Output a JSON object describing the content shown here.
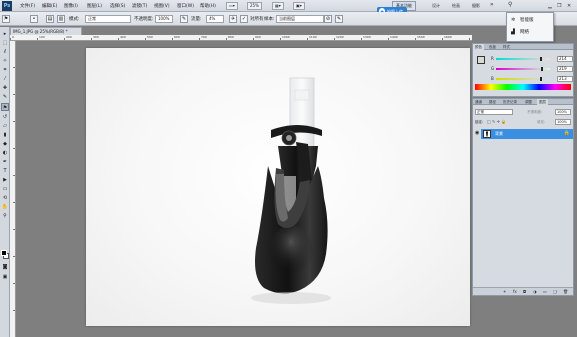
{
  "menubar": {
    "logo": "Ps",
    "items": [
      "文件(F)",
      "编辑(E)",
      "图像(I)",
      "图层(L)",
      "选择(S)",
      "滤镜(T)",
      "视图(V)",
      "窗口(W)",
      "帮助(H)"
    ],
    "zoom": "25%",
    "workspace_button": "基本功能",
    "workspace_tabs": [
      "设计",
      "绘画",
      "摄影"
    ],
    "more_label": "»"
  },
  "options": {
    "mode_label": "模式:",
    "mode_value": "正常",
    "opacity_label": "不透明度:",
    "opacity_value": "100%",
    "flow_label": "流量:",
    "flow_value": "4%",
    "sample_all_label": "对所有",
    "sample_label": "样本:",
    "sample_value": "当前图层"
  },
  "document": {
    "tab_title": "IMG_1.JPG @ 25%(RGB/8) *"
  },
  "ruler": {
    "numbers": [
      "0",
      "100",
      "200",
      "300",
      "400",
      "500",
      "600",
      "700",
      "800",
      "900",
      "1000",
      "1100",
      "1200",
      "1300",
      "1400",
      "1500",
      "1600"
    ]
  },
  "popup": {
    "pill_label": "拍照上传",
    "pill_icon": "cloud-icon",
    "items": [
      {
        "icon": "sparkle-icon",
        "label": "智能版"
      },
      {
        "icon": "signal-icon",
        "label": "网络"
      }
    ]
  },
  "color_panel": {
    "tabs": [
      "颜色",
      "色板",
      "样式"
    ],
    "channels": [
      {
        "name": "R",
        "value": "214",
        "fraction": 0.84
      },
      {
        "name": "G",
        "value": "219",
        "fraction": 0.86
      },
      {
        "name": "B",
        "value": "213",
        "fraction": 0.84
      }
    ]
  },
  "layers_panel": {
    "tabs": [
      "通道",
      "路径",
      "历史记录",
      "调整",
      "图层"
    ],
    "blend_mode": "正常",
    "opacity_label": "不透明度:",
    "opacity_value": "100%",
    "lock_label": "锁定:",
    "fill_label": "填充:",
    "fill_value": "100%",
    "layer_name": "背景"
  }
}
